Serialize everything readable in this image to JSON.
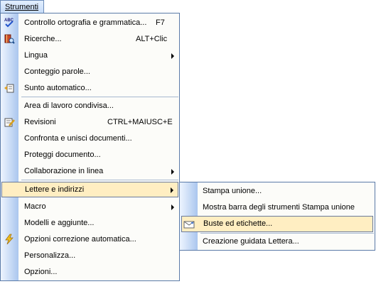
{
  "menubar": {
    "tab_label": "Strumenti"
  },
  "menu": {
    "items": [
      {
        "label": "Controllo ortografia e grammatica...",
        "shortcut": "F7",
        "icon": "spelling-abc-icon"
      },
      {
        "label": "Ricerche...",
        "shortcut": "ALT+Clic",
        "icon": "research-book-icon"
      },
      {
        "label": "Lingua",
        "submenu": true
      },
      {
        "label": "Conteggio parole..."
      },
      {
        "label": "Sunto automatico...",
        "icon": "autosummarize-icon"
      },
      {
        "label": "Area di lavoro condivisa..."
      },
      {
        "label": "Revisioni",
        "shortcut": "CTRL+MAIUSC+E",
        "icon": "track-changes-icon"
      },
      {
        "label": "Confronta e unisci documenti..."
      },
      {
        "label": "Proteggi documento..."
      },
      {
        "label": "Collaborazione in linea",
        "submenu": true
      },
      {
        "label": "Lettere e indirizzi",
        "submenu": true,
        "highlighted": true
      },
      {
        "label": "Macro",
        "submenu": true
      },
      {
        "label": "Modelli e aggiunte..."
      },
      {
        "label": "Opzioni correzione automatica...",
        "icon": "autocorrect-lightning-icon"
      },
      {
        "label": "Personalizza..."
      },
      {
        "label": "Opzioni..."
      }
    ]
  },
  "submenu": {
    "items": [
      {
        "label": "Stampa unione..."
      },
      {
        "label": "Mostra barra degli strumenti Stampa unione"
      },
      {
        "label": "Buste ed etichette...",
        "highlighted": true,
        "icon": "envelope-icon"
      },
      {
        "label": "Creazione guidata Lettera..."
      }
    ]
  },
  "colors": {
    "highlight": "#ffeec2",
    "border": "#5b7ba8",
    "gutter": "#aac6ee"
  }
}
